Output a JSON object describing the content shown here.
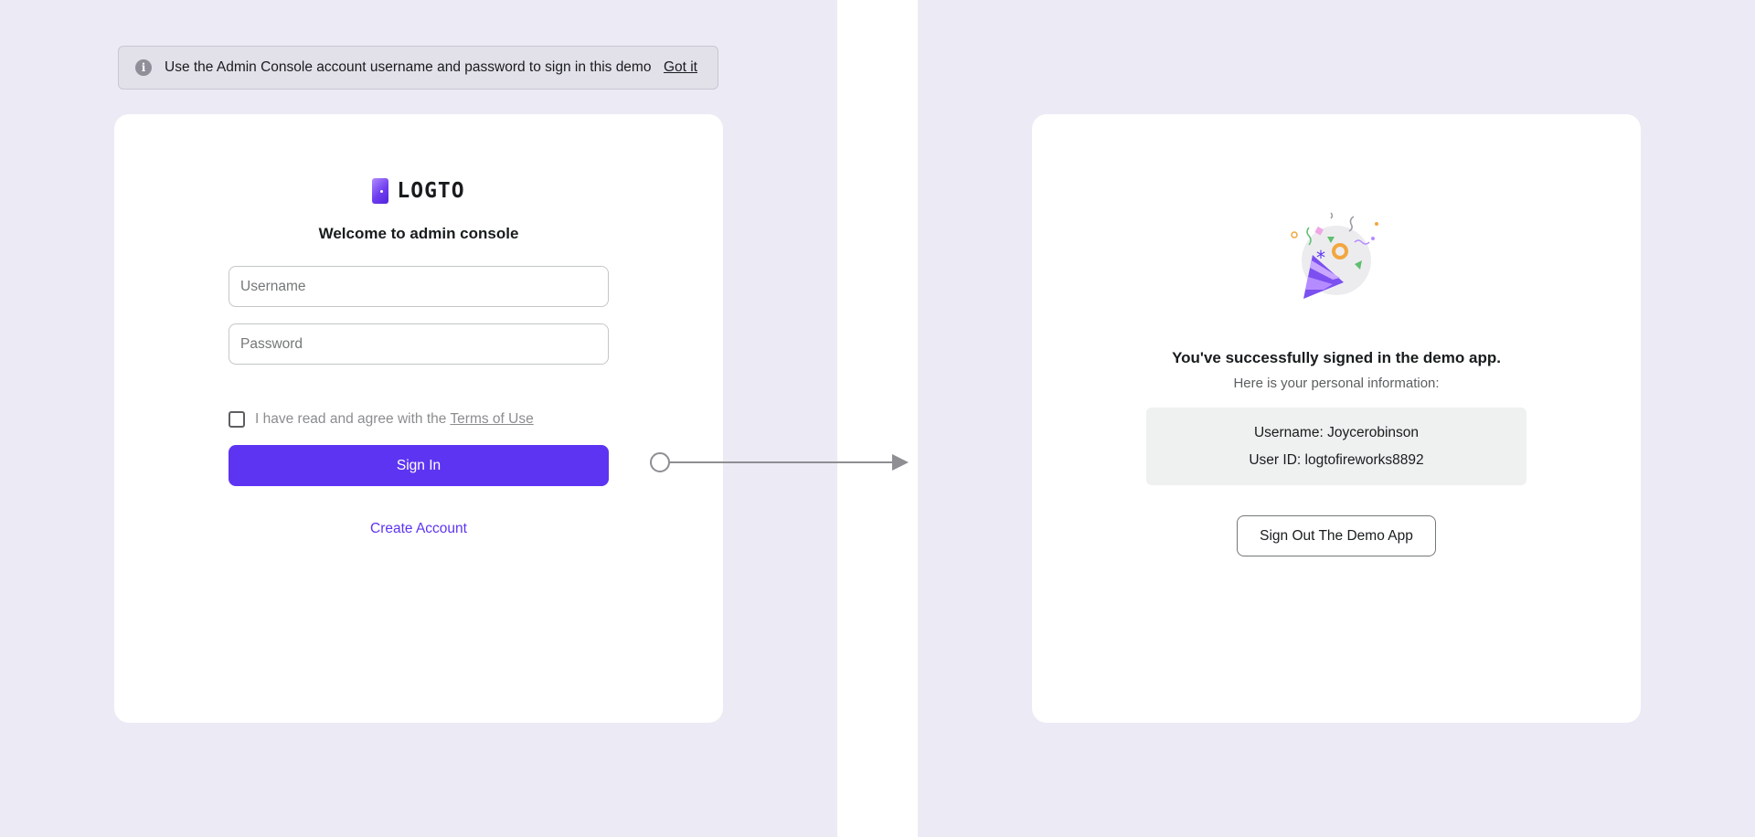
{
  "notice": {
    "icon": "info-icon",
    "text": "Use the Admin Console account username and password to sign in this demo",
    "action_label": "Got it"
  },
  "signin": {
    "logo_text": "LOGTO",
    "welcome": "Welcome to admin console",
    "username_placeholder": "Username",
    "username_value": "",
    "password_placeholder": "Password",
    "password_value": "",
    "terms_prefix": "I have read and agree with the",
    "terms_link": "Terms of Use",
    "terms_checked": false,
    "submit_label": "Sign In",
    "create_account_label": "Create Account"
  },
  "success": {
    "illustration": "party-popper-icon",
    "title": "You've successfully signed in the demo app.",
    "subtitle": "Here is your personal information:",
    "username_label": "Username:",
    "username_value": "Joycerobinson",
    "userid_label": "User ID:",
    "userid_value": "logtofireworks8892",
    "signout_label": "Sign Out The Demo App"
  },
  "colors": {
    "background": "#ebeaf5",
    "accent": "#5d34f2",
    "card": "#ffffff",
    "info_box": "#eff0f0"
  }
}
